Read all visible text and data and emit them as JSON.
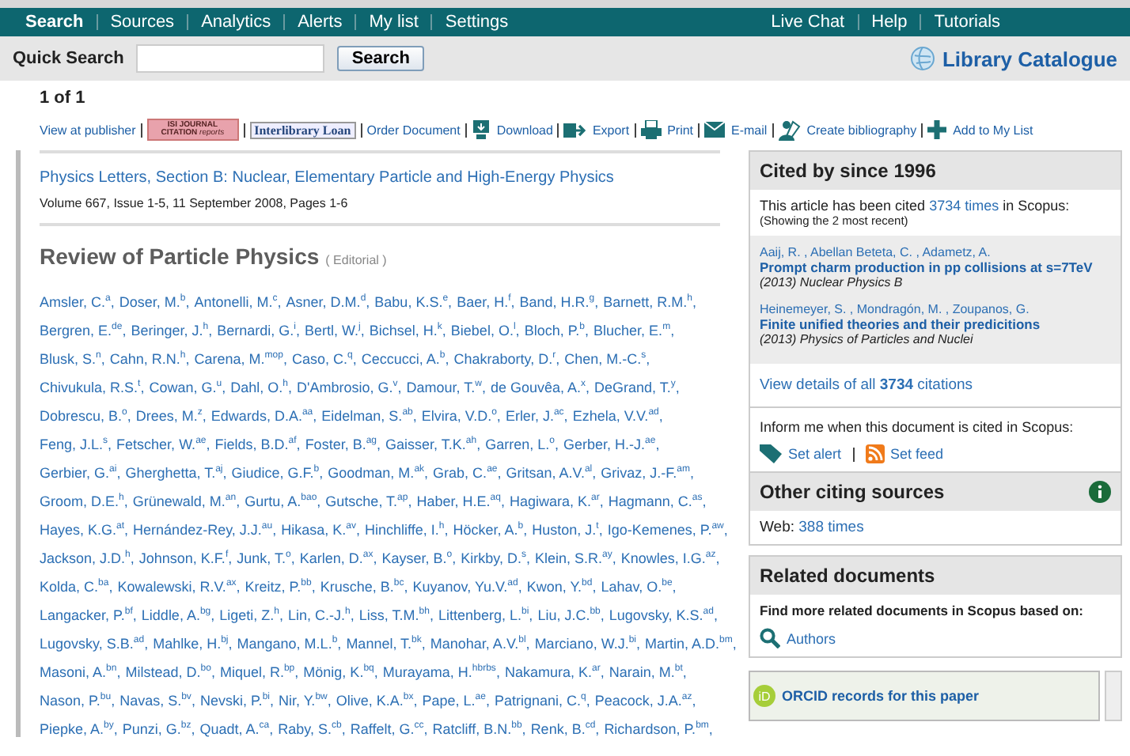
{
  "nav": {
    "primary": [
      {
        "label": "Search",
        "selected": true
      },
      {
        "label": "Sources",
        "selected": false
      },
      {
        "label": "Analytics",
        "selected": false
      },
      {
        "label": "Alerts",
        "selected": false
      },
      {
        "label": "My list",
        "selected": false
      },
      {
        "label": "Settings",
        "selected": false
      }
    ],
    "secondary": [
      {
        "label": "Live Chat",
        "selected": false
      },
      {
        "label": "Help",
        "selected": false
      },
      {
        "label": "Tutorials",
        "selected": false
      }
    ]
  },
  "quick_search": {
    "label": "Quick Search",
    "button": "Search",
    "catalogue_link": "Library Catalogue"
  },
  "result_count": "1 of 1",
  "toolbar": [
    {
      "kind": "link",
      "label": "View at publisher"
    },
    {
      "kind": "isi-badge",
      "lines": [
        "ISI JOURNAL",
        "CITATION",
        "reports"
      ]
    },
    {
      "kind": "bordered",
      "label": "Interlibrary Loan"
    },
    {
      "kind": "link",
      "label": "Order Document"
    },
    {
      "kind": "download",
      "label": "Download"
    },
    {
      "kind": "export",
      "label": "Export"
    },
    {
      "kind": "print",
      "label": "Print"
    },
    {
      "kind": "email",
      "label": "E-mail"
    },
    {
      "kind": "bibliography",
      "label": "Create bibliography"
    },
    {
      "kind": "add",
      "label": "Add to My List"
    }
  ],
  "journal": "Physics Letters, Section B: Nuclear, Elementary Particle and High-Energy Physics",
  "volume": "Volume 667, Issue 1-5, 11 September 2008, Pages 1-6",
  "title": "Review of Particle Physics",
  "doc_type": "( Editorial )",
  "author_rows": [
    [
      "Amsler, C.$^{a}$,",
      "Doser, M.$^{b}$,",
      "Antonelli, M.$^{c}$,",
      "Asner, D.M.$^{d}$,",
      "Babu, K.S.$^{e}$,",
      "Baer, H.$^{f}$,",
      "Band, H.R.$^{g}$,",
      "Barnett, R.M.$^{h}$,"
    ],
    [
      "Bergren, E.$^{de}$,",
      "Beringer, J.$^{h}$,",
      "Bernardi, G.$^{i}$,",
      "Bertl, W.$^{j}$,",
      "Bichsel, H.$^{k}$,",
      "Biebel, O.$^{l}$,",
      "Bloch, P.$^{b}$,",
      "Blucher, E.$^{m}$,"
    ],
    [
      "Blusk, S.$^{n}$,",
      "Cahn, R.N.$^{h}$,",
      "Carena, M.$^{mop}$,",
      "Caso, C.$^{q}$,",
      "Ceccucci, A.$^{b}$,",
      "Chakraborty, D.$^{r}$,",
      "Chen, M.-C.$^{s}$,"
    ],
    [
      "Chivukula, R.S.$^{t}$,",
      "Cowan, G.$^{u}$,",
      "Dahl, O.$^{h}$,",
      "D'Ambrosio, G.$^{v}$,",
      "Damour, T.$^{w}$,",
      "de Gouvêa, A.$^{x}$,",
      "DeGrand, T.$^{y}$,"
    ],
    [
      "Dobrescu, B.$^{o}$,",
      "Drees, M.$^{z}$,",
      "Edwards, D.A.$^{aa}$,",
      "Eidelman, S.$^{ab}$,",
      "Elvira, V.D.$^{o}$,",
      "Erler, J.$^{ac}$,",
      "Ezhela, V.V.$^{ad}$,"
    ],
    [
      "Feng, J.L.$^{s}$,",
      "Fetscher, W.$^{ae}$,",
      "Fields, B.D.$^{af}$,",
      "Foster, B.$^{ag}$,",
      "Gaisser, T.K.$^{ah}$,",
      "Garren, L.$^{o}$,",
      "Gerber, H.-J.$^{ae}$,"
    ],
    [
      "Gerbier, G.$^{ai}$,",
      "Gherghetta, T.$^{aj}$,",
      "Giudice, G.F.$^{b}$,",
      "Goodman, M.$^{ak}$,",
      "Grab, C.$^{ae}$,",
      "Gritsan, A.V.$^{al}$,",
      "Grivaz, J.-F.$^{am}$,"
    ],
    [
      "Groom, D.E.$^{h}$,",
      "Grünewald, M.$^{an}$,",
      "Gurtu, A.$^{bao}$,",
      "Gutsche, T.$^{ap}$,",
      "Haber, H.E.$^{aq}$,",
      "Hagiwara, K.$^{ar}$,",
      "Hagmann, C.$^{as}$,"
    ],
    [
      "Hayes, K.G.$^{at}$,",
      "Hernández-Rey, J.J.$^{au}$,",
      "Hikasa, K.$^{av}$,",
      "Hinchliffe, I.$^{h}$,",
      "Höcker, A.$^{b}$,",
      "Huston, J.$^{t}$,",
      "Igo-Kemenes, P.$^{aw}$,"
    ],
    [
      "Jackson, J.D.$^{h}$,",
      "Johnson, K.F.$^{f}$,",
      "Junk, T.$^{o}$,",
      "Karlen, D.$^{ax}$,",
      "Kayser, B.$^{o}$,",
      "Kirkby, D.$^{s}$,",
      "Klein, S.R.$^{ay}$,",
      "Knowles, I.G.$^{az}$,"
    ],
    [
      "Kolda, C.$^{ba}$,",
      "Kowalewski, R.V.$^{ax}$,",
      "Kreitz, P.$^{bb}$,",
      "Krusche, B.$^{bc}$,",
      "Kuyanov, Yu.V.$^{ad}$,",
      "Kwon, Y.$^{bd}$,",
      "Lahav, O.$^{be}$,"
    ],
    [
      "Langacker, P.$^{bf}$,",
      "Liddle, A.$^{bg}$,",
      "Ligeti, Z.$^{h}$,",
      "Lin, C.-J.$^{h}$,",
      "Liss, T.M.$^{bh}$,",
      "Littenberg, L.$^{bi}$,",
      "Liu, J.C.$^{bb}$,",
      "Lugovsky, K.S.$^{ad}$,"
    ],
    [
      "Lugovsky, S.B.$^{ad}$,",
      "Mahlke, H.$^{bj}$,",
      "Mangano, M.L.$^{b}$,",
      "Mannel, T.$^{bk}$,",
      "Manohar, A.V.$^{bl}$,",
      "Marciano, W.J.$^{bi}$,",
      "Martin, A.D.$^{bm}$,"
    ],
    [
      "Masoni, A.$^{bn}$,",
      "Milstead, D.$^{bo}$,",
      "Miquel, R.$^{bp}$,",
      "Mönig, K.$^{bq}$,",
      "Murayama, H.$^{hbrbs}$,",
      "Nakamura, K.$^{ar}$,",
      "Narain, M.$^{bt}$,"
    ],
    [
      "Nason, P.$^{bu}$,",
      "Navas, S.$^{bv}$,",
      "Nevski, P.$^{bi}$,",
      "Nir, Y.$^{bw}$,",
      "Olive, K.A.$^{bx}$,",
      "Pape, L.$^{ae}$,",
      "Patrignani, C.$^{q}$,",
      "Peacock, J.A.$^{az}$,"
    ],
    [
      "Piepke, A.$^{by}$,",
      "Punzi, G.$^{bz}$,",
      "Quadt, A.$^{ca}$,",
      "Raby, S.$^{cb}$,",
      "Raffelt, G.$^{cc}$,",
      "Ratcliff, B.N.$^{bb}$,",
      "Renk, B.$^{cd}$,",
      "Richardson, P.$^{bm}$,"
    ]
  ],
  "cited_by": {
    "heading": "Cited by since 1996",
    "sentence_before": "This article has been cited",
    "count_link": "3734 times",
    "sentence_after": "in Scopus:",
    "note": "(Showing the 2 most recent)",
    "items": [
      {
        "authors": "Aaij, R. , Abellan Beteta, C. , Adametz, A.",
        "title": "Prompt charm production in pp collisions at s=7TeV",
        "source": "(2013) Nuclear Physics B"
      },
      {
        "authors": "Heinemeyer, S. , Mondragón, M. , Zoupanos, G.",
        "title": "Finite unified theories and their predicitions",
        "source": "(2013) Physics of Particles and Nuclei"
      }
    ],
    "details_link": "View details of all **3734** citations",
    "inform": "Inform me when this document is cited in Scopus:",
    "alert_link": "Set alert",
    "feed_link": "Set feed"
  },
  "other_sources": {
    "heading": "Other citing sources",
    "label": "Web:",
    "link": "388 times"
  },
  "related": {
    "heading": "Related documents",
    "text": "Find more related documents in Scopus based on:",
    "link": "Authors"
  },
  "orcid": {
    "logo": "iD",
    "label": "ORCID records for this paper"
  }
}
